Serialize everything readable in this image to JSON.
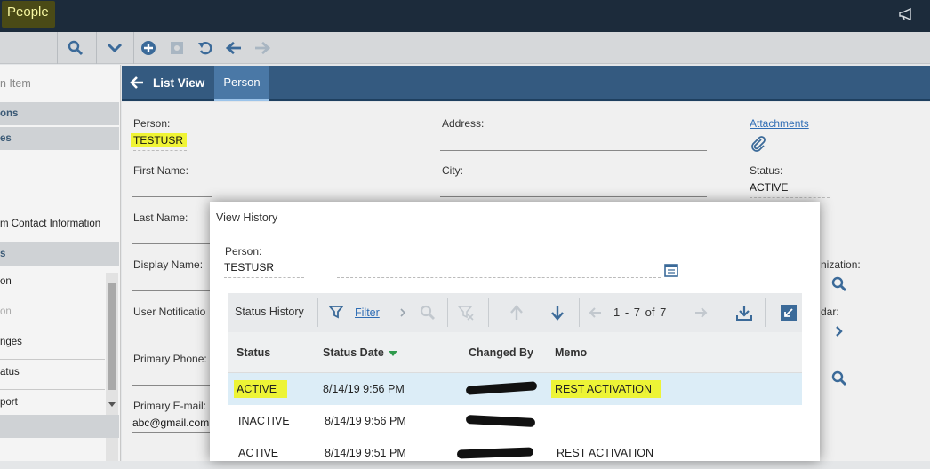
{
  "app": {
    "title": "People"
  },
  "sidebar": {
    "items": [
      {
        "label": "n Item",
        "kind": "muted"
      },
      {
        "label": "ons",
        "kind": "header"
      },
      {
        "label": "es",
        "kind": "header"
      },
      {
        "label": "m Contact Information",
        "kind": "item"
      },
      {
        "label": "s",
        "kind": "header"
      },
      {
        "label": "on",
        "kind": "item"
      },
      {
        "label": "on",
        "kind": "muted"
      },
      {
        "label": "nges",
        "kind": "item"
      },
      {
        "label": "atus",
        "kind": "item"
      },
      {
        "label": "port",
        "kind": "item"
      }
    ]
  },
  "tabs": {
    "list_view": "List View",
    "person": "Person"
  },
  "form": {
    "person_label": "Person:",
    "person_value": "TESTUSR",
    "first_name_label": "First Name:",
    "last_name_label": "Last Name:",
    "display_name_label": "Display Name:",
    "user_notification_label": "User Notificatio",
    "primary_phone_label": "Primary Phone:",
    "primary_email_label": "Primary E-mail:",
    "primary_email_value": "abc@gmail.com",
    "address_label": "Address:",
    "city_label": "City:",
    "attachments_link": "Attachments",
    "status_label": "Status:",
    "status_value": "ACTIVE",
    "organization_label": "nization:",
    "calendar_label": "dar:"
  },
  "modal": {
    "title": "View History",
    "person_label": "Person:",
    "person_value": "TESTUSR",
    "section_title": "Status History",
    "filter_label": "Filter",
    "pagination": "1 - 7 of 7",
    "columns": [
      "Status",
      "Status Date",
      "Changed By",
      "Memo"
    ],
    "rows": [
      {
        "status": "ACTIVE",
        "date": "8/14/19 9:56 PM",
        "changed_by": "",
        "memo": "REST ACTIVATION",
        "selected": true
      },
      {
        "status": "INACTIVE",
        "date": "8/14/19 9:56 PM",
        "changed_by": "",
        "memo": ""
      },
      {
        "status": "ACTIVE",
        "date": "8/14/19 9:51 PM",
        "changed_by": "",
        "memo": "REST ACTIVATION"
      }
    ]
  },
  "colors": {
    "topbar": "#1c2b3b",
    "tab_bar": "#345a80",
    "accent_blue": "#2f6db5",
    "highlight": "#f0f514",
    "selected_row": "#dcedf7"
  },
  "icons": [
    "megaphone-icon",
    "search-icon",
    "chevron-down-icon",
    "plus-circle-icon",
    "save-icon",
    "undo-icon",
    "arrow-left-icon",
    "arrow-right-icon",
    "paperclip-icon",
    "calendar-icon",
    "filter-icon",
    "clear-filter-icon",
    "sort-up-icon",
    "sort-down-icon",
    "download-icon",
    "collapse-icon",
    "chevron-right-icon"
  ]
}
